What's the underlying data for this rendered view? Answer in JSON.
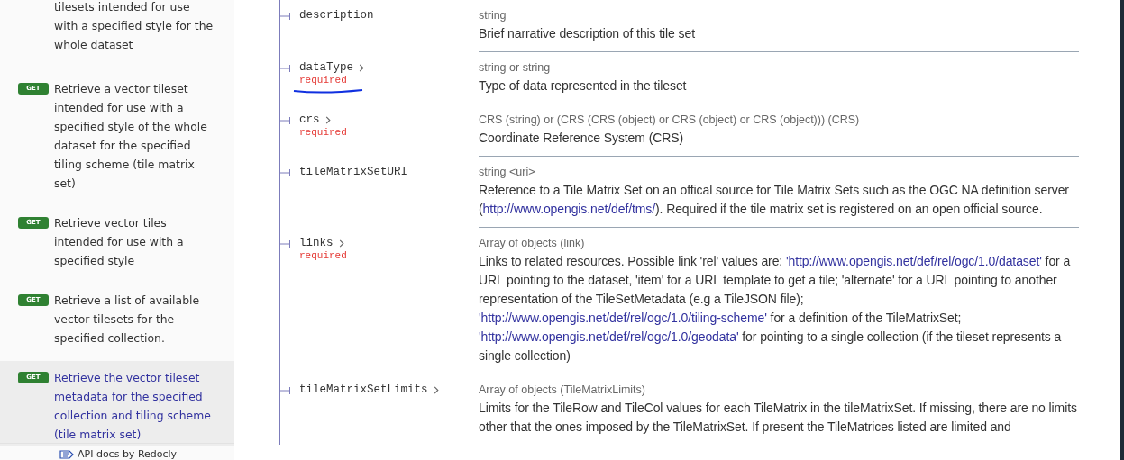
{
  "sidebar": {
    "items": [
      {
        "label": "tilesets intended for use with a specified style for the whole dataset",
        "selected": false
      },
      {
        "method": "GET",
        "label": "Retrieve a vector tileset intended for use with a specified style of the whole dataset for the specified tiling scheme (tile matrix set)",
        "selected": false
      },
      {
        "method": "GET",
        "label": "Retrieve vector tiles intended for use with a specified style",
        "selected": false
      },
      {
        "method": "GET",
        "label": "Retrieve a list of available vector tilesets for the specified collection.",
        "selected": false
      },
      {
        "method": "GET",
        "label": "Retrieve the vector tileset metadata for the specified collection and tiling scheme (tile matrix set)",
        "selected": true
      }
    ],
    "footer": "API docs by Redocly"
  },
  "properties": [
    {
      "name": "description",
      "expandable": false,
      "required": false,
      "type": "string",
      "description": [
        {
          "kind": "text",
          "text": "Brief narrative description of this tile set"
        }
      ]
    },
    {
      "name": "dataType",
      "expandable": true,
      "required": true,
      "required_label": "required",
      "type": "string or string",
      "description": [
        {
          "kind": "text",
          "text": "Type of data represented in the tileset"
        }
      ]
    },
    {
      "name": "crs",
      "expandable": true,
      "required": true,
      "required_label": "required",
      "type": "CRS (string) or (CRS (CRS (object) or CRS (object) or CRS (object))) (CRS)",
      "description": [
        {
          "kind": "text",
          "text": "Coordinate Reference System (CRS)"
        }
      ]
    },
    {
      "name": "tileMatrixSetURI",
      "expandable": false,
      "required": false,
      "type": "string <uri>",
      "description": [
        {
          "kind": "text",
          "text": "Reference to a Tile Matrix Set on an offical source for Tile Matrix Sets such as the OGC NA definition server ("
        },
        {
          "kind": "link",
          "text": "http://www.opengis.net/def/tms/"
        },
        {
          "kind": "text",
          "text": "). Required if the tile matrix set is registered on an open official source."
        }
      ]
    },
    {
      "name": "links",
      "expandable": true,
      "required": true,
      "required_label": "required",
      "type": "Array of objects (link)",
      "description": [
        {
          "kind": "text",
          "text": "Links to related resources. Possible link 'rel' values are: "
        },
        {
          "kind": "link",
          "text": "'http://www.opengis.net/def/rel/ogc/1.0/dataset'"
        },
        {
          "kind": "text",
          "text": " for a URL pointing to the dataset, 'item' for a URL template to get a tile; 'alternate' for a URL pointing to another representation of the TileSetMetadata (e.g a TileJSON file); "
        },
        {
          "kind": "link",
          "text": "'http://www.opengis.net/def/rel/ogc/1.0/tiling-scheme'"
        },
        {
          "kind": "text",
          "text": " for a definition of the TileMatrixSet; "
        },
        {
          "kind": "link",
          "text": "'http://www.opengis.net/def/rel/ogc/1.0/geodata'"
        },
        {
          "kind": "text",
          "text": " for pointing to a single collection (if the tileset represents a single collection)"
        }
      ]
    },
    {
      "name": "tileMatrixSetLimits",
      "expandable": true,
      "required": false,
      "type": "Array of objects (TileMatrixLimits)",
      "description": [
        {
          "kind": "text",
          "text": "Limits for the TileRow and TileCol values for each TileMatrix in the tileMatrixSet. If missing, there are no limits other that the ones imposed by the TileMatrixSet. If present the TileMatrices listed are limited and"
        }
      ]
    }
  ]
}
